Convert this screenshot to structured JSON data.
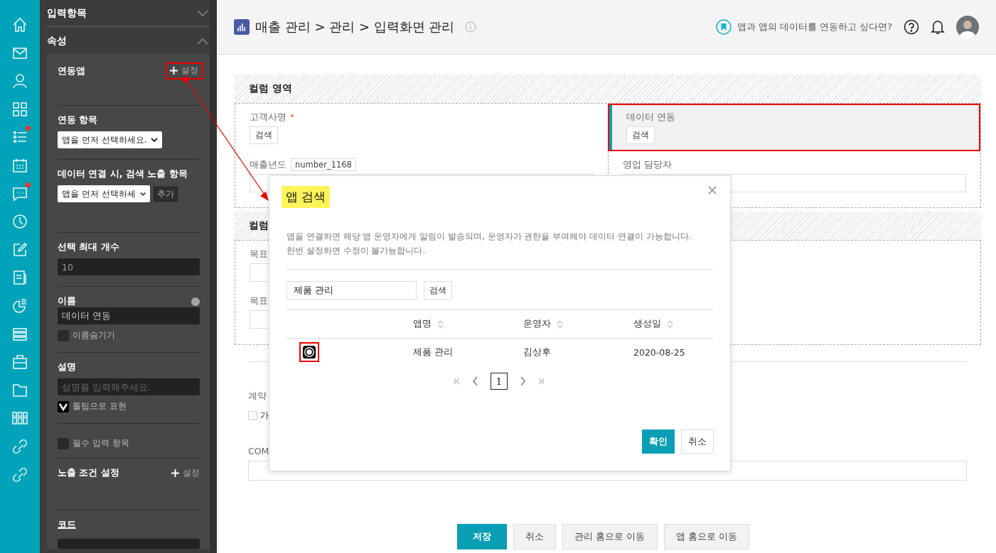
{
  "nav_rail": {
    "items": [
      {
        "kind": "home",
        "badge": false
      },
      {
        "kind": "mail",
        "badge": false
      },
      {
        "kind": "user",
        "badge": false
      },
      {
        "kind": "grid",
        "badge": false
      },
      {
        "kind": "list",
        "badge": true
      },
      {
        "kind": "calendar",
        "badge": false
      },
      {
        "kind": "chat",
        "badge": true
      },
      {
        "kind": "clock",
        "badge": false
      },
      {
        "kind": "edit",
        "badge": false
      },
      {
        "kind": "document",
        "badge": false
      },
      {
        "kind": "chart",
        "badge": false
      },
      {
        "kind": "rows",
        "badge": false
      },
      {
        "kind": "briefcase",
        "badge": false
      },
      {
        "kind": "folder",
        "badge": false
      },
      {
        "kind": "columns",
        "badge": false
      },
      {
        "kind": "link",
        "badge": false
      },
      {
        "kind": "link",
        "badge": false
      }
    ]
  },
  "panel": {
    "sections": [
      {
        "title": "입력항목",
        "expanded": false
      },
      {
        "title": "속성",
        "expanded": true
      }
    ],
    "properties": {
      "linked_app": {
        "label": "연동앱",
        "action": "설정"
      },
      "linked_field": {
        "label": "연동 항목",
        "select": "앱을 먼저 선택하세요."
      },
      "search_fields": {
        "label": "데이터 연결 시, 검색 노출 항목",
        "select": "앱을 먼저 선택하세",
        "button": "추가"
      },
      "max_count": {
        "label": "선택 최대 개수",
        "value": "10"
      },
      "name": {
        "label": "이름",
        "value": "데이터 연동",
        "hide_name": {
          "label": "이름숨기기",
          "checked": false
        }
      },
      "description": {
        "label": "설명",
        "placeholder": "설명을 입력해주세요.",
        "tooltip": {
          "label": "툴팁으로 표현",
          "checked": true
        }
      },
      "required": {
        "label": "필수 입력 항목",
        "checked": false
      },
      "visibility": {
        "label": "노출 조건 설정",
        "action": "설정"
      },
      "code": {
        "label": "코드"
      }
    }
  },
  "header": {
    "breadcrumb": "매출 관리 > 관리 > 입력화면 관리",
    "help_link": "앱과 앱의 데이터를 연동하고 싶다면?"
  },
  "form": {
    "sections": [
      {
        "title": "컬럼 영역",
        "fields": [
          {
            "kind": "search",
            "label": "고객사명",
            "required": true,
            "selected": false,
            "button": "검색"
          },
          {
            "kind": "number",
            "label": "매출년도",
            "required": false,
            "selected": false,
            "tag": "number_1168"
          },
          {
            "kind": "search",
            "label": "데이터 연동",
            "required": false,
            "selected": true,
            "button": "검색"
          },
          {
            "kind": "text",
            "label": "영업 담당자",
            "required": false,
            "selected": false
          }
        ]
      },
      {
        "title": "컬럼",
        "fields": [
          {
            "kind": "text",
            "label": "목표",
            "required": false,
            "selected": false
          },
          {
            "kind": "text",
            "label": "목표",
            "required": false,
            "selected": false
          }
        ]
      }
    ],
    "contract": {
      "label": "계약",
      "option": {
        "label": "가",
        "checked": false
      }
    },
    "comment": {
      "label": "COM"
    },
    "actions": [
      {
        "label": "저장",
        "primary": true
      },
      {
        "label": "취소",
        "primary": false
      },
      {
        "label": "관리 홈으로 이동",
        "primary": false
      },
      {
        "label": "앱 홈으로 이동",
        "primary": false
      }
    ]
  },
  "dialog": {
    "title": "앱 검색",
    "notice": [
      "앱을 연결하면 해당 앱 운영자에게 알림이 발송되며, 운영자가 권한을 부여해야 데이터 연결이 가능합니다.",
      "한번 설정하면 수정이 불가능합니다."
    ],
    "search": {
      "value": "제품 관리",
      "button": "검색"
    },
    "columns": [
      "앱명",
      "운영자",
      "생성일"
    ],
    "rows": [
      {
        "selected": true,
        "cells": [
          "제품 관리",
          "김상후",
          "2020-08-25"
        ]
      }
    ],
    "pages": [
      {
        "label": "1",
        "selected": true
      }
    ],
    "buttons": [
      {
        "label": "확인",
        "primary": true
      },
      {
        "label": "취소",
        "primary": false
      }
    ]
  }
}
